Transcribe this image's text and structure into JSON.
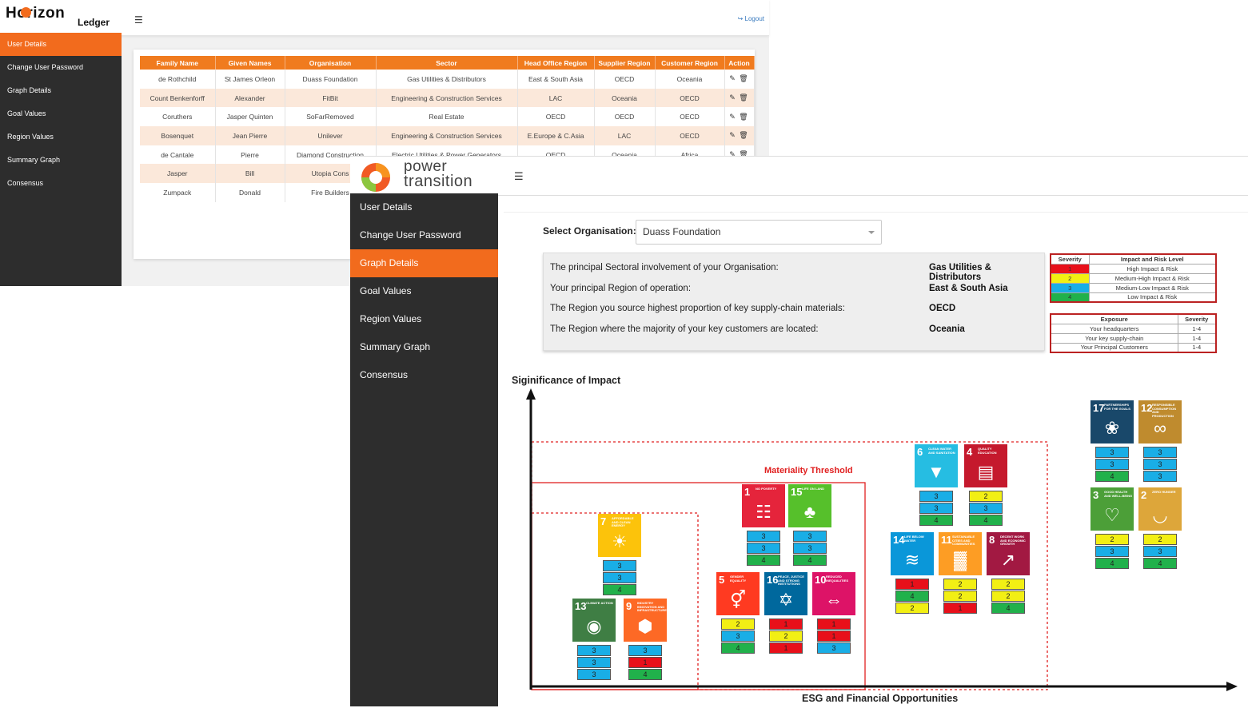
{
  "back_window": {
    "logo_main": "Horizon",
    "logo_sub": "Ledger",
    "logout": "Logout",
    "menu_icon": "hamburger-icon",
    "sidebar": [
      "User Details",
      "Change User Password",
      "Graph Details",
      "Goal Values",
      "Region Values",
      "Summary Graph",
      "Consensus"
    ],
    "active_item": "User Details",
    "table": {
      "headers": [
        "Family Name",
        "Given Names",
        "Organisation",
        "Sector",
        "Head Office Region",
        "Supplier Region",
        "Customer Region",
        "Action"
      ],
      "rows": [
        [
          "de Rothchild",
          "St James Orleon",
          "Duass Foundation",
          "Gas Utilities & Distributors",
          "East & South Asia",
          "OECD",
          "Oceania"
        ],
        [
          "Count Benkenforff",
          "Alexander",
          "FitBit",
          "Engineering & Construction Services",
          "LAC",
          "Oceania",
          "OECD"
        ],
        [
          "Coruthers",
          "Jasper Quinten",
          "SoFarRemoved",
          "Real Estate",
          "OECD",
          "OECD",
          "OECD"
        ],
        [
          "Bosenquet",
          "Jean Pierre",
          "Unilever",
          "Engineering & Construction Services",
          "E.Europe & C.Asia",
          "LAC",
          "OECD"
        ],
        [
          "de Cantale",
          "Pierre",
          "Diamond Construction",
          "Electric Utilities & Power Generators",
          "OECD",
          "Oceania",
          "Africa"
        ],
        [
          "Jasper",
          "Bill",
          "Utopia Cons",
          "",
          "",
          "",
          ""
        ],
        [
          "Zumpack",
          "Donald",
          "Fire Builders",
          "",
          "",
          "",
          ""
        ]
      ],
      "action_icons": [
        "edit-user-icon",
        "trash-icon"
      ]
    }
  },
  "front_window": {
    "logo_line1": "power",
    "logo_line2": "transition",
    "menu_icon": "hamburger-icon",
    "sidebar": [
      "User Details",
      "Change User Password",
      "Graph Details",
      "Goal Values",
      "Region Values",
      "Summary Graph",
      "Consensus"
    ],
    "active_item": "Graph Details",
    "select_label": "Select Organisation:",
    "select_value": "Duass Foundation",
    "info": [
      {
        "q": "The principal Sectoral involvement of your Organisation:",
        "a": "Gas Utilities & Distributors"
      },
      {
        "q": "Your principal Region of operation:",
        "a": "East & South Asia"
      },
      {
        "q": "The Region you source highest proportion of key supply-chain materials:",
        "a": "OECD"
      },
      {
        "q": "The Region where the majority of your key customers are located:",
        "a": "Oceania"
      }
    ],
    "severity_table": {
      "headers": [
        "Severity",
        "Impact and Risk Level"
      ],
      "rows": [
        {
          "sev": "1",
          "level": "High Impact & Risk",
          "color": "#e8101a"
        },
        {
          "sev": "2",
          "level": "Medium-High Impact & Risk",
          "color": "#f2ef14"
        },
        {
          "sev": "3",
          "level": "Medium-Low Impact & Risk",
          "color": "#19aee6"
        },
        {
          "sev": "4",
          "level": "Low Impact & Risk",
          "color": "#21b14b"
        }
      ]
    },
    "exposure_table": {
      "headers": [
        "Exposure",
        "Severity"
      ],
      "rows": [
        [
          "Your headquarters",
          "1-4"
        ],
        [
          "Your key supply-chain",
          "1-4"
        ],
        [
          "Your Principal Customers",
          "1-4"
        ]
      ]
    },
    "chart": {
      "title": "Siginificance of Impact",
      "x_title": "ESG and Financial Opportunities",
      "threshold_label": "Materiality Threshold"
    },
    "goals": [
      {
        "n": "7",
        "label": "Affordable and clean energy",
        "color": "#fcc30b",
        "icon": "sun-icon",
        "stack": [
          "3",
          "3",
          "4"
        ]
      },
      {
        "n": "13",
        "label": "Climate action",
        "color": "#3f7e44",
        "icon": "eye-globe-icon",
        "stack": [
          "3",
          "3",
          "3"
        ]
      },
      {
        "n": "9",
        "label": "Industry innovation and infrastructure",
        "color": "#fd6925",
        "icon": "cubes-icon",
        "stack": [
          "3",
          "1",
          "4"
        ]
      },
      {
        "n": "1",
        "label": "No poverty",
        "color": "#e5243b",
        "icon": "family-icon",
        "stack": [
          "3",
          "3",
          "4"
        ]
      },
      {
        "n": "15",
        "label": "Life on land",
        "color": "#56c02b",
        "icon": "tree-icon",
        "stack": [
          "3",
          "3",
          "4"
        ]
      },
      {
        "n": "5",
        "label": "Gender equality",
        "color": "#ff3a21",
        "icon": "gender-icon",
        "stack": [
          "2",
          "3",
          "4"
        ]
      },
      {
        "n": "16",
        "label": "Peace, justice and strong institutions",
        "color": "#00689d",
        "icon": "dove-icon",
        "stack": [
          "1",
          "2",
          "1"
        ]
      },
      {
        "n": "10",
        "label": "Reduced inequalities",
        "color": "#dd1367",
        "icon": "equality-icon",
        "stack": [
          "1",
          "1",
          "3"
        ]
      },
      {
        "n": "6",
        "label": "Clean water and sanitation",
        "color": "#26bde2",
        "icon": "water-drop-icon",
        "stack": [
          "3",
          "3",
          "4"
        ]
      },
      {
        "n": "4",
        "label": "Quality education",
        "color": "#c5192d",
        "icon": "book-icon",
        "stack": [
          "2",
          "3",
          "4"
        ]
      },
      {
        "n": "14",
        "label": "Life below water",
        "color": "#0a97d9",
        "icon": "fish-icon",
        "stack": [
          "1",
          "4",
          "2"
        ]
      },
      {
        "n": "11",
        "label": "Sustainable cities and communities",
        "color": "#fd9d24",
        "icon": "buildings-icon",
        "stack": [
          "2",
          "2",
          "1"
        ]
      },
      {
        "n": "8",
        "label": "Decent work and economic growth",
        "color": "#a21942",
        "icon": "growth-chart-icon",
        "stack": [
          "2",
          "2",
          "4"
        ]
      },
      {
        "n": "17",
        "label": "Partnerships for the goals",
        "color": "#19486a",
        "icon": "rings-icon",
        "stack": [
          "3",
          "3",
          "4"
        ]
      },
      {
        "n": "12",
        "label": "Responsible consumption and production",
        "color": "#bf8b2e",
        "icon": "infinity-icon",
        "stack": [
          "3",
          "3",
          "3"
        ]
      },
      {
        "n": "3",
        "label": "Good health and well-being",
        "color": "#4c9f38",
        "icon": "heartbeat-icon",
        "stack": [
          "2",
          "3",
          "4"
        ]
      },
      {
        "n": "2",
        "label": "Zero hunger",
        "color": "#dda63a",
        "icon": "bowl-icon",
        "stack": [
          "2",
          "3",
          "4"
        ]
      }
    ]
  }
}
